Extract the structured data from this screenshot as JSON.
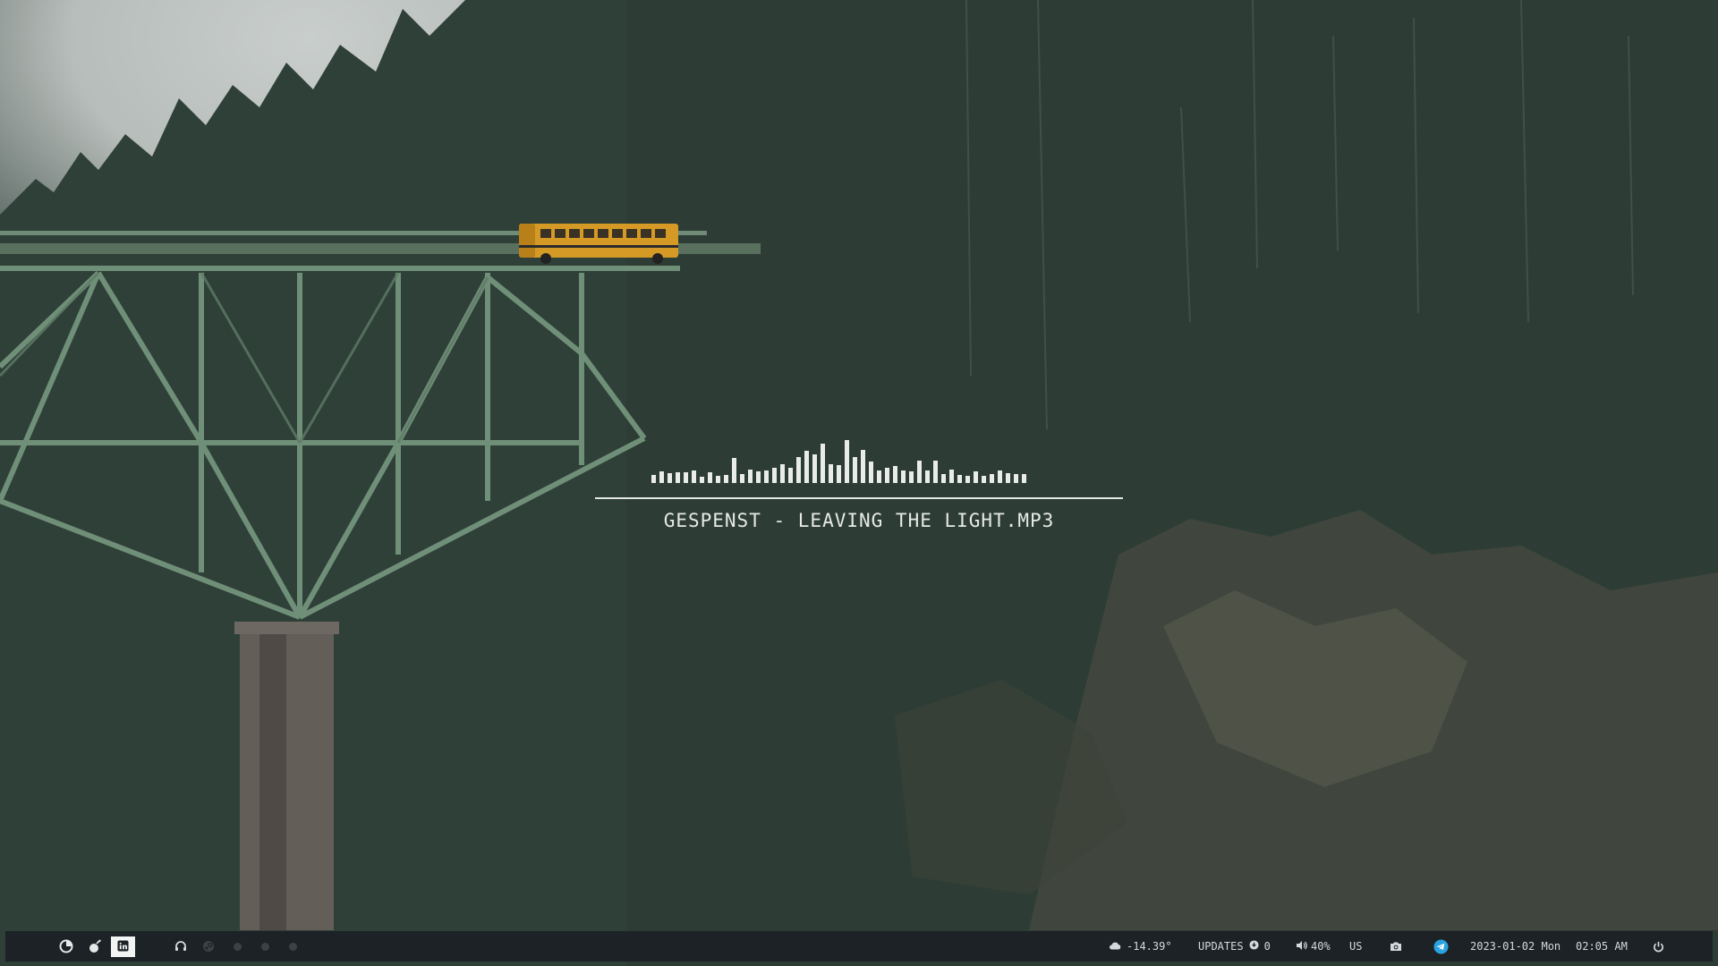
{
  "now_playing": {
    "title": "GESPENST - LEAVING THE LIGHT.MP3",
    "visualizer_levels": [
      0.18,
      0.28,
      0.22,
      0.24,
      0.26,
      0.3,
      0.14,
      0.24,
      0.16,
      0.18,
      0.58,
      0.2,
      0.32,
      0.28,
      0.3,
      0.36,
      0.44,
      0.36,
      0.6,
      0.76,
      0.66,
      0.92,
      0.44,
      0.42,
      1.0,
      0.6,
      0.78,
      0.5,
      0.3,
      0.36,
      0.4,
      0.3,
      0.28,
      0.52,
      0.3,
      0.52,
      0.2,
      0.32,
      0.18,
      0.16,
      0.28,
      0.16,
      0.2,
      0.3,
      0.22,
      0.2,
      0.2
    ]
  },
  "taskbar": {
    "launchers": [
      {
        "icon": "arch-logo-icon"
      },
      {
        "icon": "bomb-icon"
      }
    ],
    "workspaces": {
      "active_icon": "linkedin-icon",
      "others": [
        "headphones-icon",
        "steam-icon",
        "empty-dot",
        "empty-dot",
        "empty-dot"
      ]
    },
    "weather": {
      "icon": "cloud-icon",
      "value": "-14.39°"
    },
    "updates": {
      "label": "UPDATES",
      "icon": "update-icon",
      "count": "0"
    },
    "volume": {
      "icon": "speaker-icon",
      "value": "40%"
    },
    "keyboard_layout": "US",
    "screenshot_icon": "camera-icon",
    "telegram_icon": "telegram-icon",
    "date": "2023-01-02 Mon",
    "time": "02:05 AM",
    "power_icon": "power-icon"
  },
  "colors": {
    "taskbar_bg": "#1c2225",
    "text": "#d5d9db",
    "visualizer": "#e9ecea",
    "telegram": "#2aa3e0"
  }
}
